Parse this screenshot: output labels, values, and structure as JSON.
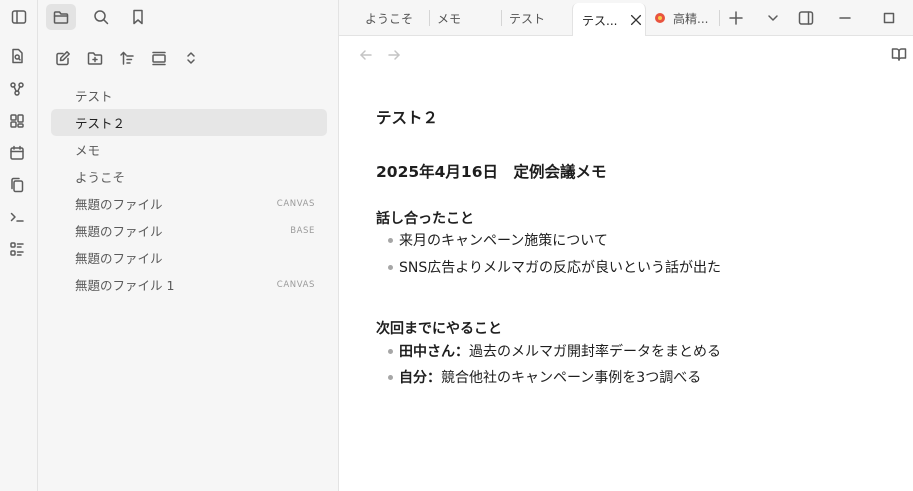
{
  "sidebar": {
    "files": [
      {
        "name": "テスト",
        "tag": "",
        "active": false
      },
      {
        "name": "テスト２",
        "tag": "",
        "active": true
      },
      {
        "name": "メモ",
        "tag": "",
        "active": false
      },
      {
        "name": "ようこそ",
        "tag": "",
        "active": false
      },
      {
        "name": "無題のファイル",
        "tag": "CANVAS",
        "active": false
      },
      {
        "name": "無題のファイル",
        "tag": "BASE",
        "active": false
      },
      {
        "name": "無題のファイル",
        "tag": "",
        "active": false
      },
      {
        "name": "無題のファイル 1",
        "tag": "CANVAS",
        "active": false
      }
    ]
  },
  "tabs": [
    {
      "label": "ようこそ"
    },
    {
      "label": "メモ"
    },
    {
      "label": "テスト"
    },
    {
      "label": "テス..."
    },
    {
      "label": "高精..."
    }
  ],
  "note": {
    "title": "テスト２",
    "heading": "2025年4月16日　定例会議メモ",
    "section1": {
      "title": "話し合ったこと",
      "items": [
        "来月のキャンペーン施策について",
        "SNS広告よりメルマガの反応が良いという話が出た"
      ]
    },
    "section2": {
      "title": "次回までにやること",
      "items": [
        {
          "who": "田中さん",
          "sep": "：",
          "text": "過去のメルマガ開封率データをまとめる"
        },
        {
          "who": "自分",
          "sep": "：",
          "text": "競合他社のキャンペーン事例を3つ調べる"
        }
      ]
    }
  },
  "colors": {
    "accent_favicon": "#e8543f",
    "sidebar_bg": "#f6f6f6",
    "active_file_bg": "#e6e6e6"
  }
}
